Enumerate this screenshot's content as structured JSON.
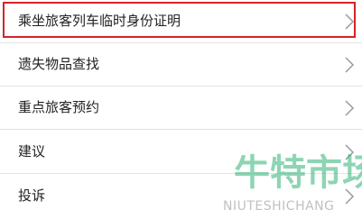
{
  "menu": {
    "items": [
      {
        "label": "乘坐旅客列车临时身份证明",
        "icon": "chevron-right-icon"
      },
      {
        "label": "遗失物品查找",
        "icon": "chevron-right-icon"
      },
      {
        "label": "重点旅客预约",
        "icon": "chevron-right-icon"
      },
      {
        "label": "建议",
        "icon": "chevron-right-icon"
      },
      {
        "label": "投诉",
        "icon": "chevron-right-icon"
      }
    ]
  },
  "watermark": {
    "cn": "牛特市场",
    "en": "NIUTESHICHANG"
  },
  "colors": {
    "highlight": "#d2232a",
    "watermark": "#2fb275"
  }
}
